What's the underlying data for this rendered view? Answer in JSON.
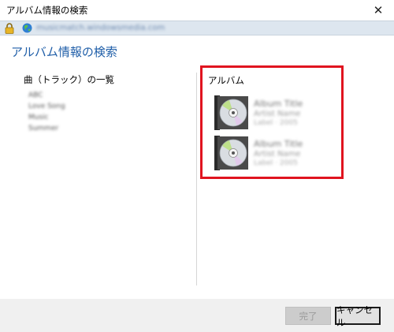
{
  "window": {
    "title": "アルバム情報の検索",
    "close_label": "✕"
  },
  "addressbar": {
    "lock_icon": "lock-icon",
    "globe_icon": "globe-icon",
    "url": "musicmatch.windowsmedia.com"
  },
  "main": {
    "heading": "アルバム情報の検索",
    "tracks_label": "曲（トラック）の一覧",
    "tracks": [
      "ABC",
      "Love Song",
      "Music",
      "Summer"
    ],
    "albums_label": "アルバム",
    "albums": [
      {
        "name": "Album Title",
        "artist": "Artist Name",
        "extra": "Label · 2005"
      },
      {
        "name": "Album Title",
        "artist": "Artist Name",
        "extra": "Label · 2005"
      }
    ]
  },
  "footer": {
    "finish_label": "完了",
    "cancel_label": "キャンセル"
  },
  "colors": {
    "heading": "#1f5ea8",
    "highlight": "#e0141f",
    "addressbar": "#dde6ef"
  }
}
